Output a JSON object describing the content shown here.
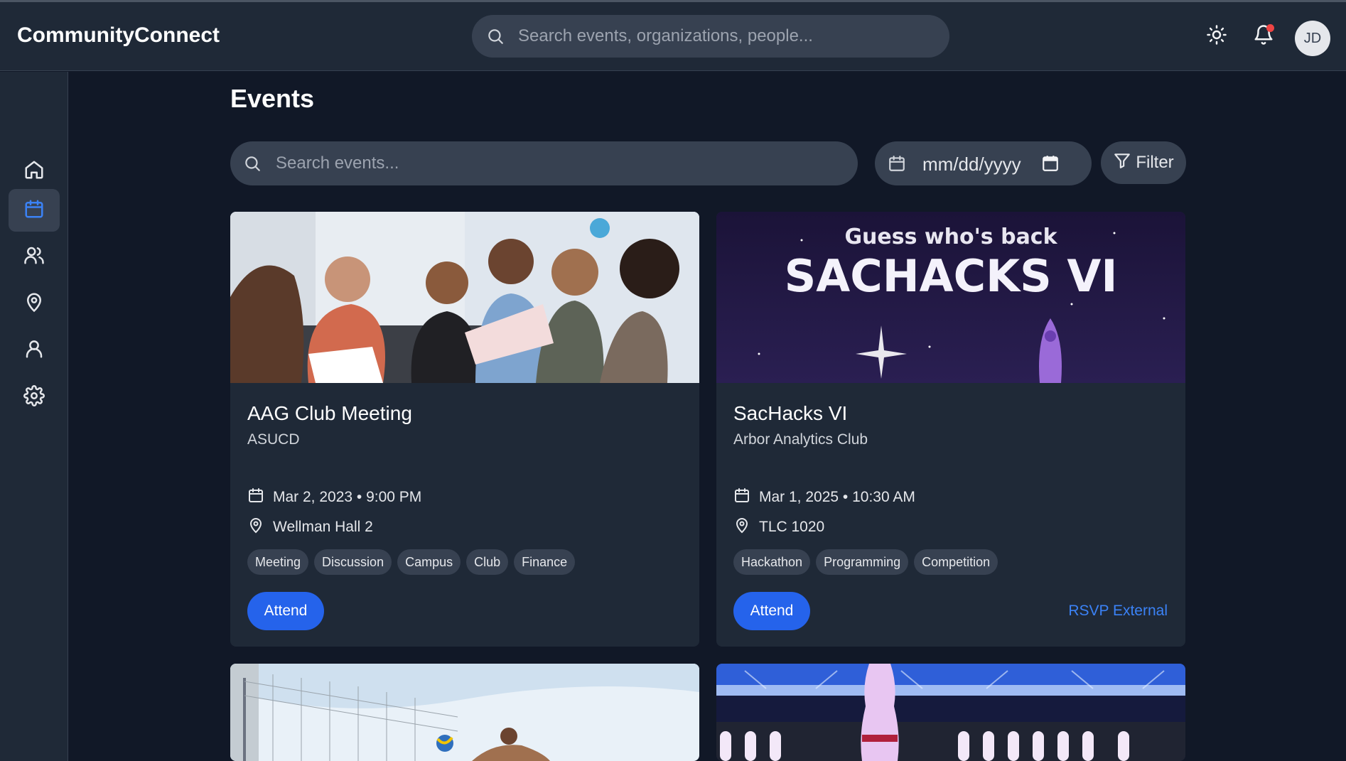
{
  "app": {
    "title": "CommunityConnect"
  },
  "header": {
    "search_placeholder": "Search events, organizations, people...",
    "avatar_initials": "JD",
    "has_notification": true
  },
  "sidebar": {
    "items": [
      {
        "icon": "home-icon",
        "active": false
      },
      {
        "icon": "calendar-icon",
        "active": true
      },
      {
        "icon": "users-icon",
        "active": false
      },
      {
        "icon": "map-pin-icon",
        "active": false
      },
      {
        "icon": "user-icon",
        "active": false
      },
      {
        "icon": "settings-icon",
        "active": false
      }
    ]
  },
  "main": {
    "title": "Events",
    "search_placeholder": "Search events...",
    "date_placeholder": "mm/dd/yyyy",
    "filter_label": "Filter"
  },
  "events": [
    {
      "title": "AAG Club Meeting",
      "org": "ASUCD",
      "datetime": "Mar 2, 2023 • 9:00 PM",
      "location": "Wellman Hall 2",
      "tags": [
        "Meeting",
        "Discussion",
        "Campus",
        "Club",
        "Finance"
      ],
      "attend_label": "Attend"
    },
    {
      "title": "SacHacks VI",
      "org": "Arbor Analytics Club",
      "datetime": "Mar 1, 2025 • 10:30 AM",
      "location": "TLC 1020",
      "tags": [
        "Hackathon",
        "Programming",
        "Competition"
      ],
      "attend_label": "Attend",
      "rsvp_label": "RSVP External",
      "banner_line1": "Guess who's back",
      "banner_line2": "SACHACKS VI"
    }
  ],
  "colors": {
    "accent": "#2563eb",
    "link": "#3b82f6",
    "surface": "#1f2937",
    "background": "#111827"
  }
}
